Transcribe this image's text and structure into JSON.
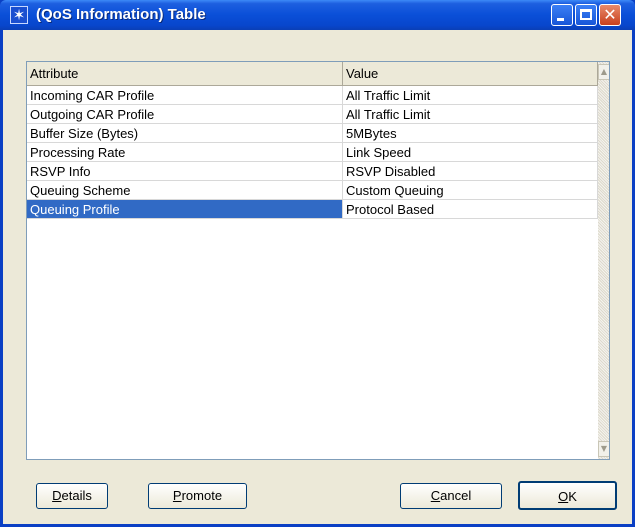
{
  "window": {
    "title": "(QoS Information) Table"
  },
  "table": {
    "columns": [
      "Attribute",
      "Value"
    ],
    "rows": [
      {
        "attribute": "Incoming CAR Profile",
        "value": "All Traffic Limit"
      },
      {
        "attribute": "Outgoing CAR Profile",
        "value": "All Traffic Limit"
      },
      {
        "attribute": "Buffer Size (Bytes)",
        "value": "5MBytes"
      },
      {
        "attribute": "Processing Rate",
        "value": "Link Speed"
      },
      {
        "attribute": "RSVP Info",
        "value": "RSVP Disabled"
      },
      {
        "attribute": "Queuing Scheme",
        "value": "Custom Queuing"
      },
      {
        "attribute": "Queuing Profile",
        "value": "Protocol Based"
      }
    ],
    "selected_row": 6
  },
  "buttons": {
    "details": {
      "label": "Details",
      "mnemonic": "D",
      "rest": "etails"
    },
    "promote": {
      "label": "Promote",
      "mnemonic": "P",
      "rest": "romote"
    },
    "cancel": {
      "label": "Cancel",
      "mnemonic": "C",
      "rest": "ancel"
    },
    "ok": {
      "label": "OK",
      "mnemonic": "O",
      "rest": "K"
    }
  },
  "icons": {
    "app": "star-burst-icon",
    "minimize": "minimize-icon",
    "maximize": "maximize-icon",
    "close": "close-icon",
    "scroll_up": "scroll-up-arrow-icon",
    "scroll_down": "scroll-down-arrow-icon"
  },
  "colors": {
    "titlebar": "#0a4fd8",
    "selection": "#316ac5",
    "dialog_bg": "#ece9d8",
    "close_button": "#c8401e"
  }
}
